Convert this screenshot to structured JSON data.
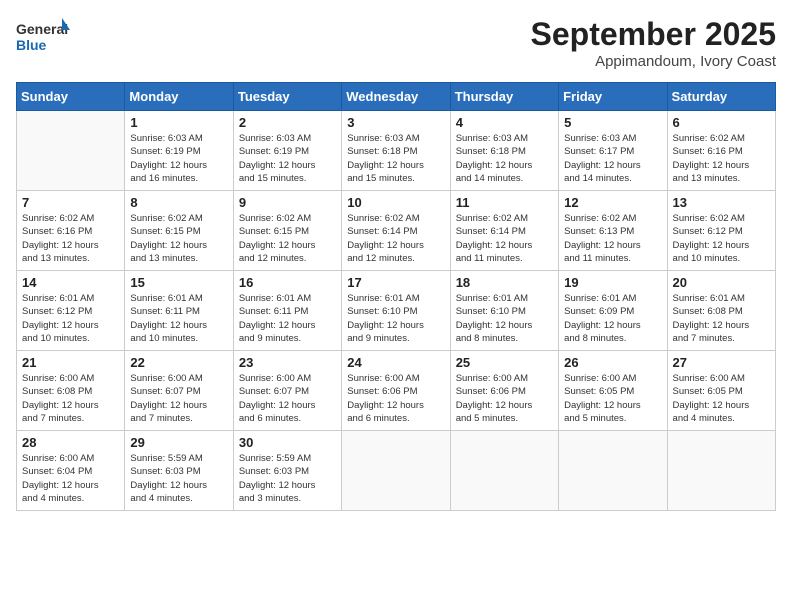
{
  "header": {
    "logo_line1": "General",
    "logo_line2": "Blue",
    "month": "September 2025",
    "location": "Appimandoum, Ivory Coast"
  },
  "weekdays": [
    "Sunday",
    "Monday",
    "Tuesday",
    "Wednesday",
    "Thursday",
    "Friday",
    "Saturday"
  ],
  "weeks": [
    [
      {
        "num": "",
        "info": ""
      },
      {
        "num": "1",
        "info": "Sunrise: 6:03 AM\nSunset: 6:19 PM\nDaylight: 12 hours\nand 16 minutes."
      },
      {
        "num": "2",
        "info": "Sunrise: 6:03 AM\nSunset: 6:19 PM\nDaylight: 12 hours\nand 15 minutes."
      },
      {
        "num": "3",
        "info": "Sunrise: 6:03 AM\nSunset: 6:18 PM\nDaylight: 12 hours\nand 15 minutes."
      },
      {
        "num": "4",
        "info": "Sunrise: 6:03 AM\nSunset: 6:18 PM\nDaylight: 12 hours\nand 14 minutes."
      },
      {
        "num": "5",
        "info": "Sunrise: 6:03 AM\nSunset: 6:17 PM\nDaylight: 12 hours\nand 14 minutes."
      },
      {
        "num": "6",
        "info": "Sunrise: 6:02 AM\nSunset: 6:16 PM\nDaylight: 12 hours\nand 13 minutes."
      }
    ],
    [
      {
        "num": "7",
        "info": "Sunrise: 6:02 AM\nSunset: 6:16 PM\nDaylight: 12 hours\nand 13 minutes."
      },
      {
        "num": "8",
        "info": "Sunrise: 6:02 AM\nSunset: 6:15 PM\nDaylight: 12 hours\nand 13 minutes."
      },
      {
        "num": "9",
        "info": "Sunrise: 6:02 AM\nSunset: 6:15 PM\nDaylight: 12 hours\nand 12 minutes."
      },
      {
        "num": "10",
        "info": "Sunrise: 6:02 AM\nSunset: 6:14 PM\nDaylight: 12 hours\nand 12 minutes."
      },
      {
        "num": "11",
        "info": "Sunrise: 6:02 AM\nSunset: 6:14 PM\nDaylight: 12 hours\nand 11 minutes."
      },
      {
        "num": "12",
        "info": "Sunrise: 6:02 AM\nSunset: 6:13 PM\nDaylight: 12 hours\nand 11 minutes."
      },
      {
        "num": "13",
        "info": "Sunrise: 6:02 AM\nSunset: 6:12 PM\nDaylight: 12 hours\nand 10 minutes."
      }
    ],
    [
      {
        "num": "14",
        "info": "Sunrise: 6:01 AM\nSunset: 6:12 PM\nDaylight: 12 hours\nand 10 minutes."
      },
      {
        "num": "15",
        "info": "Sunrise: 6:01 AM\nSunset: 6:11 PM\nDaylight: 12 hours\nand 10 minutes."
      },
      {
        "num": "16",
        "info": "Sunrise: 6:01 AM\nSunset: 6:11 PM\nDaylight: 12 hours\nand 9 minutes."
      },
      {
        "num": "17",
        "info": "Sunrise: 6:01 AM\nSunset: 6:10 PM\nDaylight: 12 hours\nand 9 minutes."
      },
      {
        "num": "18",
        "info": "Sunrise: 6:01 AM\nSunset: 6:10 PM\nDaylight: 12 hours\nand 8 minutes."
      },
      {
        "num": "19",
        "info": "Sunrise: 6:01 AM\nSunset: 6:09 PM\nDaylight: 12 hours\nand 8 minutes."
      },
      {
        "num": "20",
        "info": "Sunrise: 6:01 AM\nSunset: 6:08 PM\nDaylight: 12 hours\nand 7 minutes."
      }
    ],
    [
      {
        "num": "21",
        "info": "Sunrise: 6:00 AM\nSunset: 6:08 PM\nDaylight: 12 hours\nand 7 minutes."
      },
      {
        "num": "22",
        "info": "Sunrise: 6:00 AM\nSunset: 6:07 PM\nDaylight: 12 hours\nand 7 minutes."
      },
      {
        "num": "23",
        "info": "Sunrise: 6:00 AM\nSunset: 6:07 PM\nDaylight: 12 hours\nand 6 minutes."
      },
      {
        "num": "24",
        "info": "Sunrise: 6:00 AM\nSunset: 6:06 PM\nDaylight: 12 hours\nand 6 minutes."
      },
      {
        "num": "25",
        "info": "Sunrise: 6:00 AM\nSunset: 6:06 PM\nDaylight: 12 hours\nand 5 minutes."
      },
      {
        "num": "26",
        "info": "Sunrise: 6:00 AM\nSunset: 6:05 PM\nDaylight: 12 hours\nand 5 minutes."
      },
      {
        "num": "27",
        "info": "Sunrise: 6:00 AM\nSunset: 6:05 PM\nDaylight: 12 hours\nand 4 minutes."
      }
    ],
    [
      {
        "num": "28",
        "info": "Sunrise: 6:00 AM\nSunset: 6:04 PM\nDaylight: 12 hours\nand 4 minutes."
      },
      {
        "num": "29",
        "info": "Sunrise: 5:59 AM\nSunset: 6:03 PM\nDaylight: 12 hours\nand 4 minutes."
      },
      {
        "num": "30",
        "info": "Sunrise: 5:59 AM\nSunset: 6:03 PM\nDaylight: 12 hours\nand 3 minutes."
      },
      {
        "num": "",
        "info": ""
      },
      {
        "num": "",
        "info": ""
      },
      {
        "num": "",
        "info": ""
      },
      {
        "num": "",
        "info": ""
      }
    ]
  ]
}
